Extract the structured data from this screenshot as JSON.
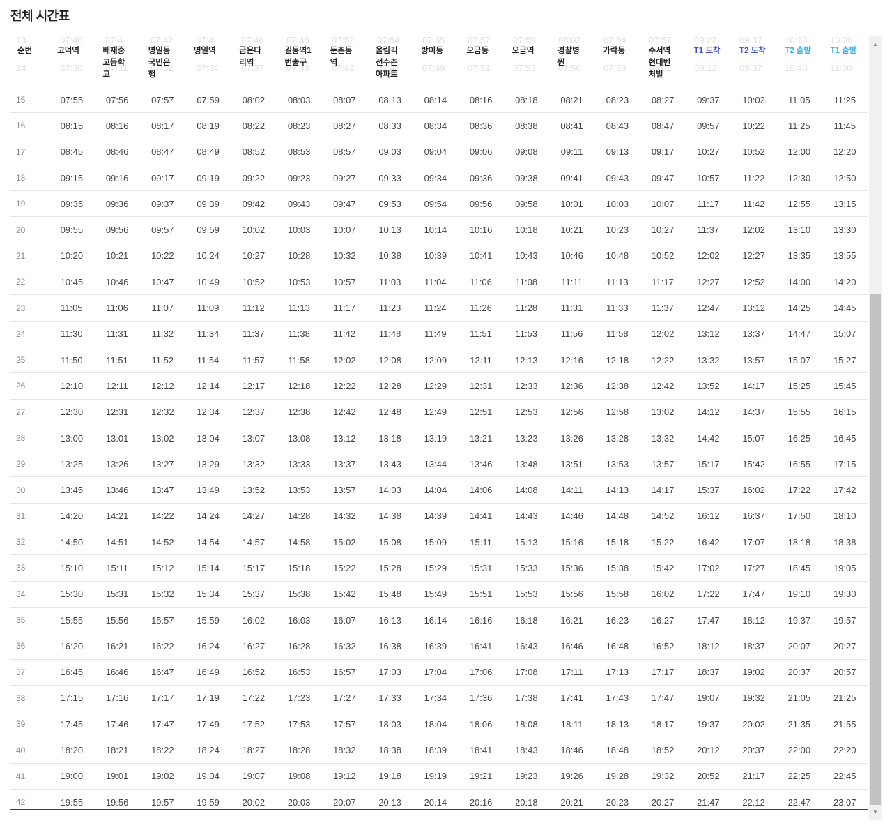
{
  "title": "전체 시간표",
  "columns": [
    {
      "label": "순번",
      "class": ""
    },
    {
      "label": "고덕역",
      "class": ""
    },
    {
      "label": "배재중고등학교",
      "class": ""
    },
    {
      "label": "명일동국민은행",
      "class": ""
    },
    {
      "label": "명일역",
      "class": ""
    },
    {
      "label": "굽은다리역",
      "class": ""
    },
    {
      "label": "길동역1번출구",
      "class": ""
    },
    {
      "label": "둔촌동역",
      "class": ""
    },
    {
      "label": "올림픽선수촌아파트",
      "class": ""
    },
    {
      "label": "방이동",
      "class": ""
    },
    {
      "label": "오금동",
      "class": ""
    },
    {
      "label": "오금역",
      "class": ""
    },
    {
      "label": "경찰병원",
      "class": ""
    },
    {
      "label": "가락동",
      "class": ""
    },
    {
      "label": "수서역현대벤처빌",
      "class": ""
    },
    {
      "label": "T1 도착",
      "class": "blue1"
    },
    {
      "label": "T2 도착",
      "class": "blue2"
    },
    {
      "label": "T2 출발",
      "class": "cyan"
    },
    {
      "label": "T1 출발",
      "class": "cyan"
    }
  ],
  "ghost_rows": [
    [
      "13",
      "07:40",
      "07:4",
      "07:42",
      "07:4",
      "07:46",
      "07:48",
      "07:52",
      "07:54",
      "07:55",
      "07:57",
      "07:59",
      "08:02",
      "07:54",
      "07:57",
      "09:22",
      "09:37",
      "10:10",
      "10:30"
    ],
    [
      "14",
      "07:30",
      "07:31",
      "07:32",
      "07:34",
      "07:37",
      "07:38",
      "07:42",
      "07:48",
      "07:49",
      "07:51",
      "07:53",
      "07:56",
      "07:58",
      "08:02",
      "09:12",
      "09:37",
      "10:40",
      "11:00"
    ]
  ],
  "rows": [
    [
      "15",
      "07:55",
      "07:56",
      "07:57",
      "07:59",
      "08:02",
      "08:03",
      "08:07",
      "08:13",
      "08:14",
      "08:16",
      "08:18",
      "08:21",
      "08:23",
      "08:27",
      "09:37",
      "10:02",
      "11:05",
      "11:25"
    ],
    [
      "16",
      "08:15",
      "08:16",
      "08:17",
      "08:19",
      "08:22",
      "08:23",
      "08:27",
      "08:33",
      "08:34",
      "08:36",
      "08:38",
      "08:41",
      "08:43",
      "08:47",
      "09:57",
      "10:22",
      "11:25",
      "11:45"
    ],
    [
      "17",
      "08:45",
      "08:46",
      "08:47",
      "08:49",
      "08:52",
      "08:53",
      "08:57",
      "09:03",
      "09:04",
      "09:06",
      "09:08",
      "09:11",
      "09:13",
      "09:17",
      "10:27",
      "10:52",
      "12:00",
      "12:20"
    ],
    [
      "18",
      "09:15",
      "09:16",
      "09:17",
      "09:19",
      "09:22",
      "09:23",
      "09:27",
      "09:33",
      "09:34",
      "09:36",
      "09:38",
      "09:41",
      "09:43",
      "09:47",
      "10:57",
      "11:22",
      "12:30",
      "12:50"
    ],
    [
      "19",
      "09:35",
      "09:36",
      "09:37",
      "09:39",
      "09:42",
      "09:43",
      "09:47",
      "09:53",
      "09:54",
      "09:56",
      "09:58",
      "10:01",
      "10:03",
      "10:07",
      "11:17",
      "11:42",
      "12:55",
      "13:15"
    ],
    [
      "20",
      "09:55",
      "09:56",
      "09:57",
      "09:59",
      "10:02",
      "10:03",
      "10:07",
      "10:13",
      "10:14",
      "10:16",
      "10:18",
      "10:21",
      "10:23",
      "10:27",
      "11:37",
      "12:02",
      "13:10",
      "13:30"
    ],
    [
      "21",
      "10:20",
      "10:21",
      "10:22",
      "10:24",
      "10:27",
      "10:28",
      "10:32",
      "10:38",
      "10:39",
      "10:41",
      "10:43",
      "10:46",
      "10:48",
      "10:52",
      "12:02",
      "12:27",
      "13:35",
      "13:55"
    ],
    [
      "22",
      "10:45",
      "10:46",
      "10:47",
      "10:49",
      "10:52",
      "10:53",
      "10:57",
      "11:03",
      "11:04",
      "11:06",
      "11:08",
      "11:11",
      "11:13",
      "11:17",
      "12:27",
      "12:52",
      "14:00",
      "14:20"
    ],
    [
      "23",
      "11:05",
      "11:06",
      "11:07",
      "11:09",
      "11:12",
      "11:13",
      "11:17",
      "11:23",
      "11:24",
      "11:26",
      "11:28",
      "11:31",
      "11:33",
      "11:37",
      "12:47",
      "13:12",
      "14:25",
      "14:45"
    ],
    [
      "24",
      "11:30",
      "11:31",
      "11:32",
      "11:34",
      "11:37",
      "11:38",
      "11:42",
      "11:48",
      "11:49",
      "11:51",
      "11:53",
      "11:56",
      "11:58",
      "12:02",
      "13:12",
      "13:37",
      "14:47",
      "15:07"
    ],
    [
      "25",
      "11:50",
      "11:51",
      "11:52",
      "11:54",
      "11:57",
      "11:58",
      "12:02",
      "12:08",
      "12:09",
      "12:11",
      "12:13",
      "12:16",
      "12:18",
      "12:22",
      "13:32",
      "13:57",
      "15:07",
      "15:27"
    ],
    [
      "26",
      "12:10",
      "12:11",
      "12:12",
      "12:14",
      "12:17",
      "12:18",
      "12:22",
      "12:28",
      "12:29",
      "12:31",
      "12:33",
      "12:36",
      "12:38",
      "12:42",
      "13:52",
      "14:17",
      "15:25",
      "15:45"
    ],
    [
      "27",
      "12:30",
      "12:31",
      "12:32",
      "12:34",
      "12:37",
      "12:38",
      "12:42",
      "12:48",
      "12:49",
      "12:51",
      "12:53",
      "12:56",
      "12:58",
      "13:02",
      "14:12",
      "14:37",
      "15:55",
      "16:15"
    ],
    [
      "28",
      "13:00",
      "13:01",
      "13:02",
      "13:04",
      "13:07",
      "13:08",
      "13:12",
      "13:18",
      "13:19",
      "13:21",
      "13:23",
      "13:26",
      "13:28",
      "13:32",
      "14:42",
      "15:07",
      "16:25",
      "16:45"
    ],
    [
      "29",
      "13:25",
      "13:26",
      "13:27",
      "13:29",
      "13:32",
      "13:33",
      "13:37",
      "13:43",
      "13:44",
      "13:46",
      "13:48",
      "13:51",
      "13:53",
      "13:57",
      "15:17",
      "15:42",
      "16:55",
      "17:15"
    ],
    [
      "30",
      "13:45",
      "13:46",
      "13:47",
      "13:49",
      "13:52",
      "13:53",
      "13:57",
      "14:03",
      "14:04",
      "14:06",
      "14:08",
      "14:11",
      "14:13",
      "14:17",
      "15:37",
      "16:02",
      "17:22",
      "17:42"
    ],
    [
      "31",
      "14:20",
      "14:21",
      "14:22",
      "14:24",
      "14:27",
      "14:28",
      "14:32",
      "14:38",
      "14:39",
      "14:41",
      "14:43",
      "14:46",
      "14:48",
      "14:52",
      "16:12",
      "16:37",
      "17:50",
      "18:10"
    ],
    [
      "32",
      "14:50",
      "14:51",
      "14:52",
      "14:54",
      "14:57",
      "14:58",
      "15:02",
      "15:08",
      "15:09",
      "15:11",
      "15:13",
      "15:16",
      "15:18",
      "15:22",
      "16:42",
      "17:07",
      "18:18",
      "18:38"
    ],
    [
      "33",
      "15:10",
      "15:11",
      "15:12",
      "15:14",
      "15:17",
      "15:18",
      "15:22",
      "15:28",
      "15:29",
      "15:31",
      "15:33",
      "15:36",
      "15:38",
      "15:42",
      "17:02",
      "17:27",
      "18:45",
      "19:05"
    ],
    [
      "34",
      "15:30",
      "15:31",
      "15:32",
      "15:34",
      "15:37",
      "15:38",
      "15:42",
      "15:48",
      "15:49",
      "15:51",
      "15:53",
      "15:56",
      "15:58",
      "16:02",
      "17:22",
      "17:47",
      "19:10",
      "19:30"
    ],
    [
      "35",
      "15:55",
      "15:56",
      "15:57",
      "15:59",
      "16:02",
      "16:03",
      "16:07",
      "16:13",
      "16:14",
      "16:16",
      "16:18",
      "16:21",
      "16:23",
      "16:27",
      "17:47",
      "18:12",
      "19:37",
      "19:57"
    ],
    [
      "36",
      "16:20",
      "16:21",
      "16:22",
      "16:24",
      "16:27",
      "16:28",
      "16:32",
      "16:38",
      "16:39",
      "16:41",
      "16:43",
      "16:46",
      "16:48",
      "16:52",
      "18:12",
      "18:37",
      "20:07",
      "20:27"
    ],
    [
      "37",
      "16:45",
      "16:46",
      "16:47",
      "16:49",
      "16:52",
      "16:53",
      "16:57",
      "17:03",
      "17:04",
      "17:06",
      "17:08",
      "17:11",
      "17:13",
      "17:17",
      "18:37",
      "19:02",
      "20:37",
      "20:57"
    ],
    [
      "38",
      "17:15",
      "17:16",
      "17:17",
      "17:19",
      "17:22",
      "17:23",
      "17:27",
      "17:33",
      "17:34",
      "17:36",
      "17:38",
      "17:41",
      "17:43",
      "17:47",
      "19:07",
      "19:32",
      "21:05",
      "21:25"
    ],
    [
      "39",
      "17:45",
      "17:46",
      "17:47",
      "17:49",
      "17:52",
      "17:53",
      "17:57",
      "18:03",
      "18:04",
      "18:06",
      "18:08",
      "18:11",
      "18:13",
      "18:17",
      "19:37",
      "20:02",
      "21:35",
      "21:55"
    ],
    [
      "40",
      "18:20",
      "18:21",
      "18:22",
      "18:24",
      "18:27",
      "18:28",
      "18:32",
      "18:38",
      "18:39",
      "18:41",
      "18:43",
      "18:46",
      "18:48",
      "18:52",
      "20:12",
      "20:37",
      "22:00",
      "22:20"
    ],
    [
      "41",
      "19:00",
      "19:01",
      "19:02",
      "19:04",
      "19:07",
      "19:08",
      "19:12",
      "19:18",
      "19:19",
      "19:21",
      "19:23",
      "19:26",
      "19:28",
      "19:32",
      "20:52",
      "21:17",
      "22:25",
      "22:45"
    ],
    [
      "42",
      "19:55",
      "19:56",
      "19:57",
      "19:59",
      "20:02",
      "20:03",
      "20:07",
      "20:13",
      "20:14",
      "20:16",
      "20:18",
      "20:21",
      "20:23",
      "20:27",
      "21:47",
      "22:12",
      "22:47",
      "23:07"
    ]
  ],
  "scrollbar": {
    "up_icon": "chevron-up-icon",
    "down_icon": "chevron-down-icon"
  }
}
